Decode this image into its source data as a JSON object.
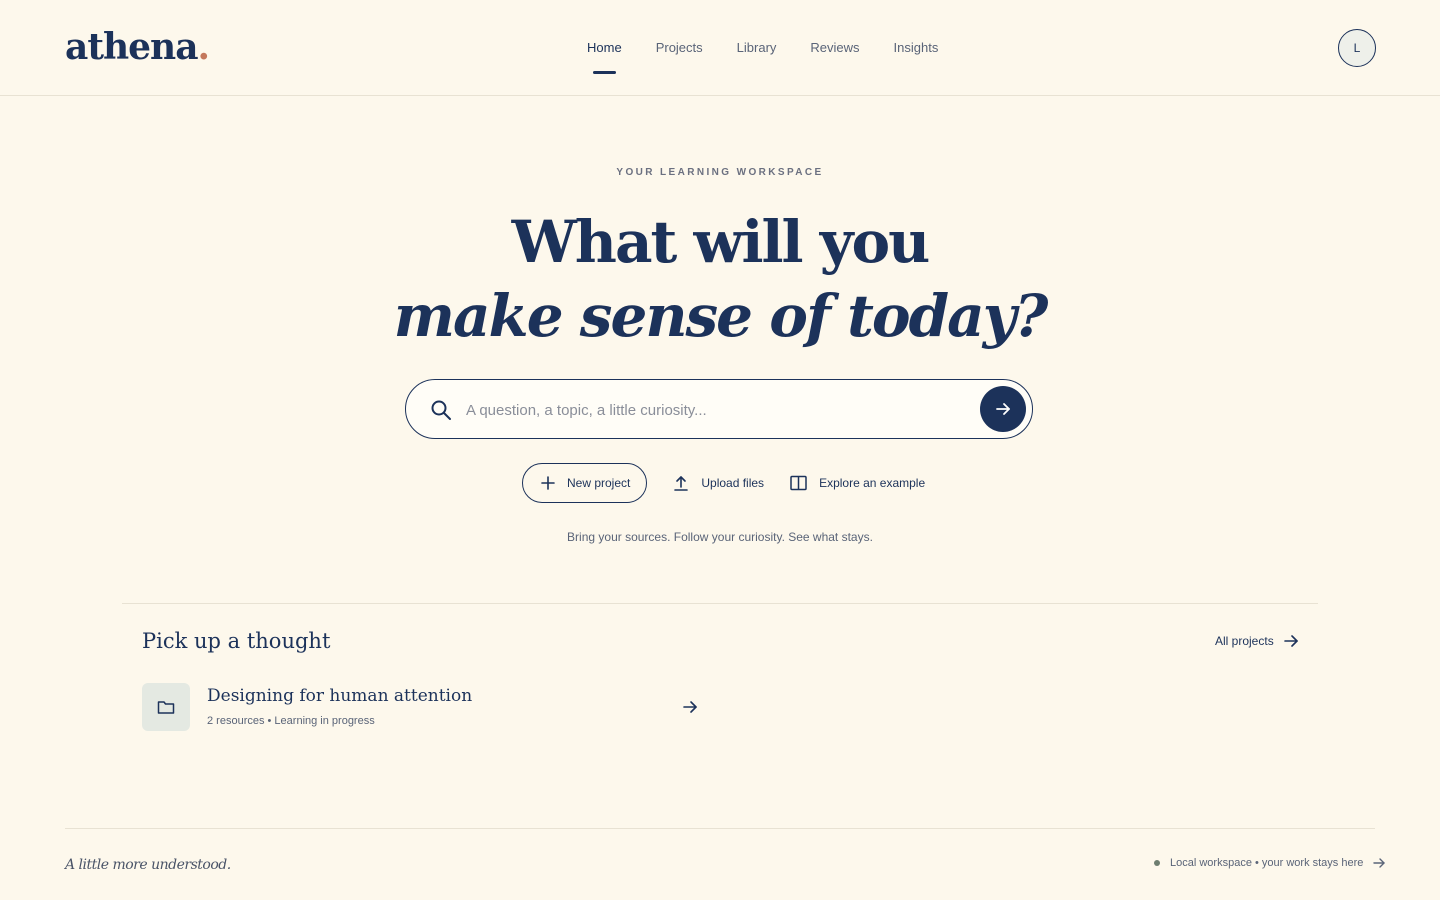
{
  "header": {
    "logo_text": "athena",
    "logo_dot": ".",
    "nav": [
      {
        "label": "Home",
        "active": true
      },
      {
        "label": "Projects",
        "active": false
      },
      {
        "label": "Library",
        "active": false
      },
      {
        "label": "Reviews",
        "active": false
      },
      {
        "label": "Insights",
        "active": false
      }
    ],
    "avatar_initial": "L"
  },
  "hero": {
    "eyebrow": "YOUR LEARNING WORKSPACE",
    "headline_line1": "What will you",
    "headline_line2": "make sense of today?",
    "search_placeholder": "A question, a topic, a little curiosity...",
    "search_value": "",
    "search_icon": "search-icon",
    "submit_icon": "arrow-right-icon",
    "actions": [
      {
        "label": "New project",
        "icon": "plus-icon"
      },
      {
        "label": "Upload files",
        "icon": "upload-icon"
      },
      {
        "label": "Explore an example",
        "icon": "book-open-icon"
      }
    ],
    "tagline": "Bring your sources. Follow your curiosity. See what stays."
  },
  "recent": {
    "title": "Pick up a thought",
    "all_projects_label": "All projects",
    "projects": [
      {
        "name": "Designing for human attention",
        "meta": "2 resources • Learning in progress",
        "icon": "folder-icon"
      }
    ]
  },
  "footer": {
    "motto": "A little more understood.",
    "status_text": "Local workspace • your work stays here",
    "status_color": "#6e7e70"
  },
  "colors": {
    "background": "#fdf8ec",
    "primary": "#1c325a",
    "accent_dot": "#c4785c",
    "muted_text": "#5a6478"
  }
}
